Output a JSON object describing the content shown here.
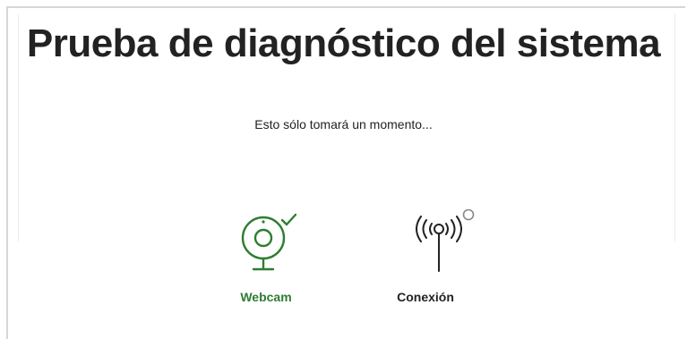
{
  "page": {
    "title": "Prueba de diagnóstico del sistema",
    "subtitle": "Esto sólo tomará un momento..."
  },
  "checks": [
    {
      "label": "Webcam",
      "status": "passed",
      "icon": "webcam-icon",
      "status_icon": "checkmark-icon",
      "color": "#2e7d32"
    },
    {
      "label": "Conexión",
      "status": "pending",
      "icon": "antenna-icon",
      "status_icon": "spinner-icon",
      "color": "#222222"
    }
  ],
  "colors": {
    "success": "#2e7d32",
    "text": "#222222"
  }
}
